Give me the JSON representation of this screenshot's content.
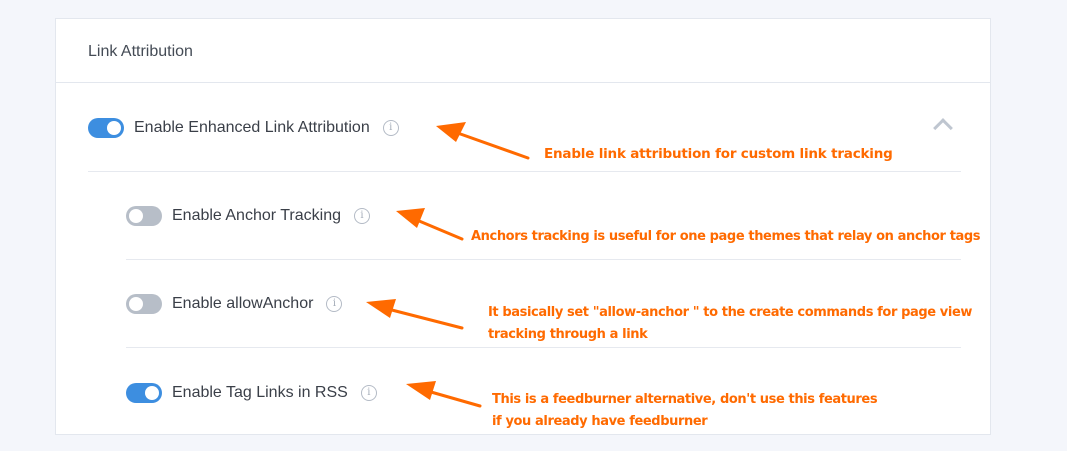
{
  "panel": {
    "title": "Link Attribution"
  },
  "settings": [
    {
      "label": "Enable Enhanced Link Attribution",
      "enabled": true
    },
    {
      "label": "Enable Anchor Tracking",
      "enabled": false
    },
    {
      "label": "Enable allowAnchor",
      "enabled": false
    },
    {
      "label": "Enable Tag Links in RSS",
      "enabled": true
    }
  ],
  "info_glyph": "i",
  "annotations": [
    {
      "line1": "Enable link attribution for custom link tracking",
      "line2": ""
    },
    {
      "line1": "Anchors tracking is useful for one page themes that relay on anchor tags",
      "line2": ""
    },
    {
      "line1": "It basically set \"allow-anchor \" to the create commands for page view",
      "line2": "tracking through a link"
    },
    {
      "line1": "This is a feedburner alternative, don't use this features",
      "line2": " if you already have feedburner"
    }
  ],
  "colors": {
    "accent": "#3d8ee0",
    "toggle_off": "#b7bec8",
    "annotation": "#ff6a00"
  }
}
